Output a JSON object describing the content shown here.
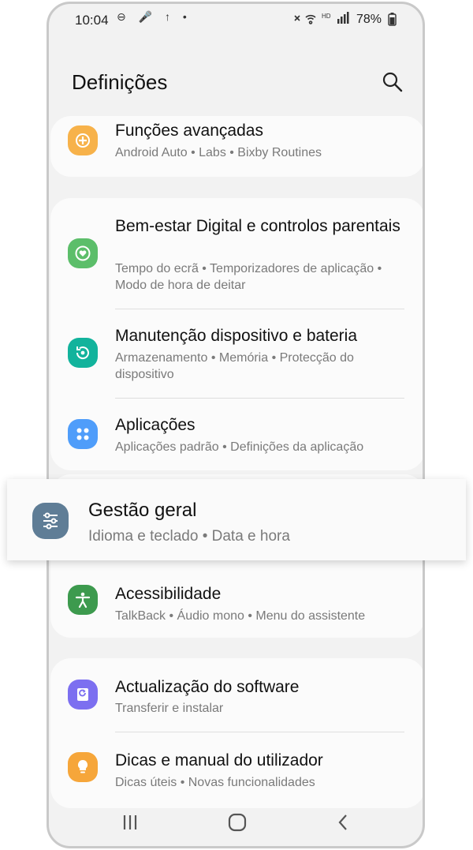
{
  "status_bar": {
    "time": "10:04",
    "left_icons": "⊖ 🎤 ↑ •",
    "battery": "78%"
  },
  "header": {
    "title": "Definições"
  },
  "items": [
    {
      "title": "Funções avançadas",
      "subtitle": "Android Auto  •  Labs  •  Bixby Routines",
      "color": "#f7b24a",
      "icon": "plus-gear-icon"
    },
    {
      "title": "Bem-estar Digital e controlos parentais",
      "subtitle": "Tempo do ecrã  •  Temporizadores de aplicação  •  Modo de hora de deitar",
      "color": "#5cbe6a",
      "icon": "heart-circle-icon"
    },
    {
      "title": "Manutenção dispositivo e bateria",
      "subtitle": "Armazenamento  •  Memória  •  Protecção do dispositivo",
      "color": "#12b39c",
      "icon": "refresh-circle-icon"
    },
    {
      "title": "Aplicações",
      "subtitle": "Aplicações padrão  •  Definições da aplicação",
      "color": "#4f9dfa",
      "icon": "apps-grid-icon"
    },
    {
      "title": "Gestão geral",
      "subtitle": "Idioma e teclado  •  Data e hora",
      "color": "#5f7d96",
      "icon": "sliders-icon"
    },
    {
      "title": "Acessibilidade",
      "subtitle": "TalkBack  •  Áudio mono  •  Menu do assistente",
      "color": "#3d9a4e",
      "icon": "person-icon"
    },
    {
      "title": "Actualização do software",
      "subtitle": "Transferir e instalar",
      "color": "#7c6ff0",
      "icon": "update-icon"
    },
    {
      "title": "Dicas e manual do utilizador",
      "subtitle": "Dicas úteis  •  Novas funcionalidades",
      "color": "#f6a63a",
      "icon": "bulb-icon"
    }
  ]
}
